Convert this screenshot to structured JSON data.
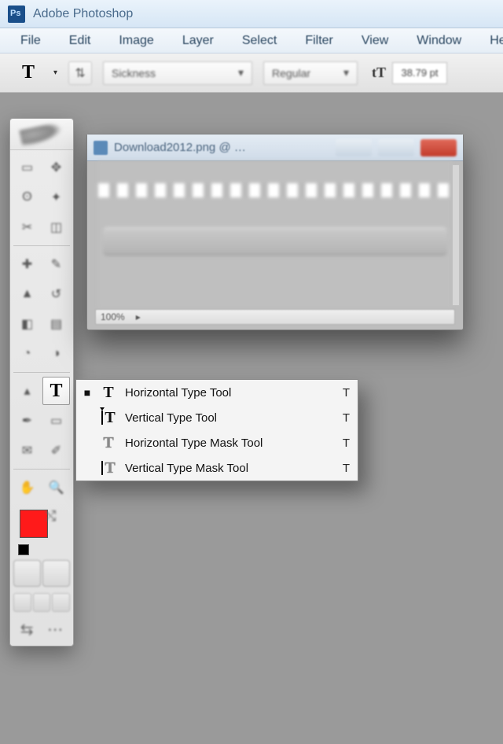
{
  "app": {
    "title": "Adobe Photoshop"
  },
  "menu": [
    "File",
    "Edit",
    "Image",
    "Layer",
    "Select",
    "Filter",
    "View",
    "Window",
    "Help"
  ],
  "options": {
    "tool_glyph": "T",
    "font_family": "Sickness",
    "font_style": "Regular",
    "size_label": "38.79 pt"
  },
  "document": {
    "title": "Download2012.png @ …",
    "zoom": "100%"
  },
  "type_flyout": [
    {
      "selected": true,
      "icon": "horizontal-type-icon",
      "label": "Horizontal Type Tool",
      "shortcut": "T"
    },
    {
      "selected": false,
      "icon": "vertical-type-icon",
      "label": "Vertical Type Tool",
      "shortcut": "T"
    },
    {
      "selected": false,
      "icon": "horizontal-type-mask-icon",
      "label": "Horizontal Type Mask Tool",
      "shortcut": "T"
    },
    {
      "selected": false,
      "icon": "vertical-type-mask-icon",
      "label": "Vertical Type Mask Tool",
      "shortcut": "T"
    }
  ],
  "swatches": {
    "foreground": "#ff1a1a",
    "background": "#ffffff"
  }
}
